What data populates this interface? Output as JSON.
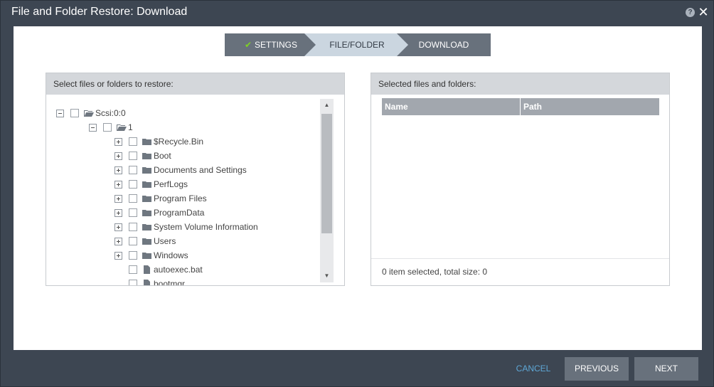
{
  "window": {
    "title": "File and Folder Restore: Download",
    "help_icon": "question-circle-icon",
    "help_label": "?",
    "close_icon": "close-icon",
    "close_label": "✕"
  },
  "wizard": {
    "steps": [
      {
        "label": "SETTINGS",
        "state": "completed",
        "icon": "check-icon",
        "icon_glyph": "✔"
      },
      {
        "label": "FILE/FOLDER",
        "state": "active"
      },
      {
        "label": "DOWNLOAD",
        "state": "pending"
      }
    ]
  },
  "left_panel": {
    "header": "Select files or folders to restore:",
    "tree": [
      {
        "label": "Scsi:0:0",
        "toggle": "minus",
        "icon": "folder-open-icon",
        "depth": 0
      },
      {
        "label": "1",
        "toggle": "minus",
        "icon": "folder-open-icon",
        "depth": 1
      },
      {
        "label": "$Recycle.Bin",
        "toggle": "plus",
        "icon": "folder-icon",
        "depth": 2
      },
      {
        "label": "Boot",
        "toggle": "plus",
        "icon": "folder-icon",
        "depth": 2
      },
      {
        "label": "Documents and Settings",
        "toggle": "plus",
        "icon": "folder-icon",
        "depth": 2
      },
      {
        "label": "PerfLogs",
        "toggle": "plus",
        "icon": "folder-icon",
        "depth": 2
      },
      {
        "label": "Program Files",
        "toggle": "plus",
        "icon": "folder-icon",
        "depth": 2
      },
      {
        "label": "ProgramData",
        "toggle": "plus",
        "icon": "folder-icon",
        "depth": 2
      },
      {
        "label": "System Volume Information",
        "toggle": "plus",
        "icon": "folder-icon",
        "depth": 2
      },
      {
        "label": "Users",
        "toggle": "plus",
        "icon": "folder-icon",
        "depth": 2
      },
      {
        "label": "Windows",
        "toggle": "plus",
        "icon": "folder-icon",
        "depth": 2
      },
      {
        "label": "autoexec.bat",
        "toggle": "none",
        "icon": "file-icon",
        "depth": 2
      },
      {
        "label": "bootmgr",
        "toggle": "none",
        "icon": "file-icon",
        "depth": 2
      }
    ],
    "scroll_up_glyph": "▲",
    "scroll_down_glyph": "▼"
  },
  "right_panel": {
    "header": "Selected files and folders:",
    "columns": [
      "Name",
      "Path"
    ],
    "footer": "0 item selected, total size: 0"
  },
  "footer": {
    "cancel_label": "CANCEL",
    "previous_label": "PREVIOUS",
    "next_label": "NEXT"
  },
  "colors": {
    "chrome": "#3d4652",
    "step_dark": "#68717c",
    "step_active": "#cbd6e0",
    "check": "#7ed321",
    "link": "#5ea7d6",
    "table_header": "#a2a7ae"
  }
}
